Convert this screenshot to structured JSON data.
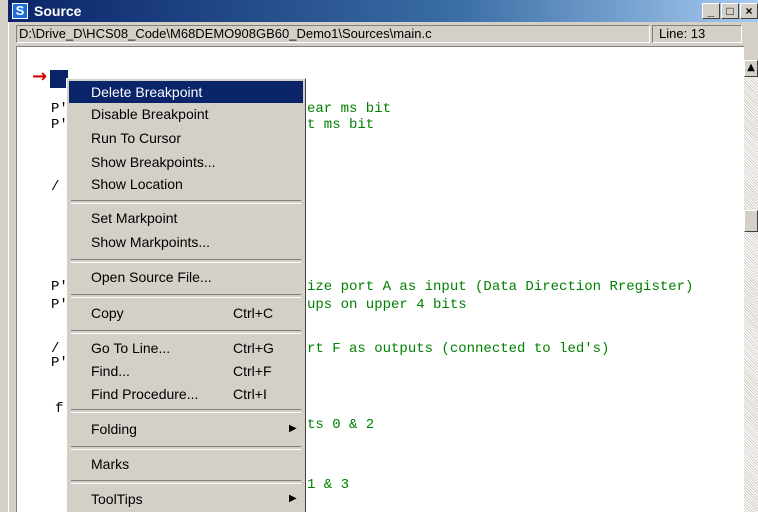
{
  "window": {
    "icon_letter": "S",
    "title": "Source",
    "min_glyph": "_",
    "max_glyph": "□",
    "close_glyph": "×"
  },
  "pathbar": {
    "path": "D:\\Drive_D\\HCS08_Code\\M68DEMO908GB60_Demo1\\Sources\\main.c",
    "line": "Line: 13"
  },
  "editor": {
    "breakpoint_glyph": "→",
    "lines": [
      {
        "text": "P'",
        "comment": "ear ms bit"
      },
      {
        "text": "P'",
        "comment": "t ms bit"
      },
      {
        "text": "/",
        "comment": ""
      },
      {
        "text": "P'",
        "comment": "ize port A as input (Data Direction Rregister)"
      },
      {
        "text": "P'",
        "comment": "ups on upper 4 bits"
      },
      {
        "text": "/",
        "comment": "rt F as outputs (connected to led's)"
      },
      {
        "text": "P'",
        "comment": ""
      },
      {
        "text": "f",
        "comment": ""
      },
      {
        "text": "",
        "comment": "ts 0 & 2"
      },
      {
        "text": "",
        "comment": "1 & 3"
      }
    ]
  },
  "scrollbar": {
    "up_glyph": "▲"
  },
  "context_menu": {
    "items": [
      {
        "label": "Delete Breakpoint",
        "shortcut": "",
        "selected": true
      },
      {
        "label": "Disable Breakpoint",
        "shortcut": ""
      },
      {
        "label": "Run To Cursor",
        "shortcut": ""
      },
      {
        "label": "Show Breakpoints...",
        "shortcut": ""
      },
      {
        "label": "Show Location",
        "shortcut": ""
      },
      {
        "label": "Set Markpoint",
        "shortcut": ""
      },
      {
        "label": "Show Markpoints...",
        "shortcut": ""
      },
      {
        "label": "Open Source File...",
        "shortcut": ""
      },
      {
        "label": "Copy",
        "shortcut": "Ctrl+C"
      },
      {
        "label": "Go To Line...",
        "shortcut": "Ctrl+G"
      },
      {
        "label": "Find...",
        "shortcut": "Ctrl+F"
      },
      {
        "label": "Find Procedure...",
        "shortcut": "Ctrl+I"
      },
      {
        "label": "Folding",
        "shortcut": ""
      },
      {
        "label": "Marks",
        "shortcut": ""
      },
      {
        "label": "ToolTips",
        "shortcut": ""
      }
    ],
    "submenu_glyph": "▶"
  },
  "colors": {
    "title_bar": "#0a246a",
    "selection": "#0a246a",
    "comment": "#008000",
    "breakpoint": "#d40000",
    "face": "#d4d0c8"
  }
}
